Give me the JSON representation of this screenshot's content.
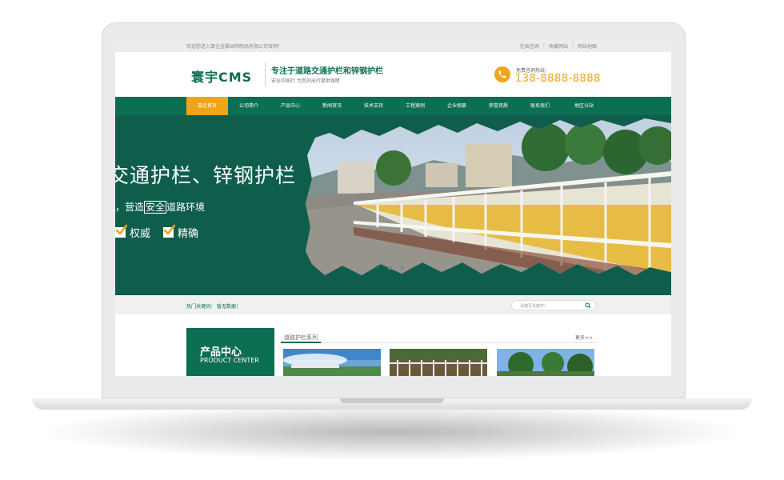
{
  "topbar": {
    "welcome": "欢迎您进入寰企金属丝网制品有限公司官网！",
    "links": [
      "在线咨询",
      "收藏网站",
      "网站地图"
    ]
  },
  "header": {
    "logo": "寰宇CMS",
    "slogan": "专注于道路交通护栏和锌钢护栏",
    "subslogan": "安全中国行 为您的出行提供保障",
    "hotline_label": "免费咨询热线：",
    "hotline": "138-8888-8888"
  },
  "nav": {
    "items": [
      "寰企首页",
      "公司简介",
      "产品中心",
      "新闻资讯",
      "技术支持",
      "工程案例",
      "企业相册",
      "荣誉资质",
      "联系我们",
      "地区分站"
    ],
    "active_index": 0
  },
  "banner": {
    "headline": "交通护栏、锌钢护栏",
    "subline_pre": "，营造",
    "subline_boxed": "安全",
    "subline_post": "道路环境",
    "checks": [
      "权威",
      "精确"
    ],
    "slide_count": 3,
    "active_slide": 0
  },
  "hotbar": {
    "label": "热门关键词：  暂无数据！",
    "search_placeholder": "请填写关键字！"
  },
  "products": {
    "box_title": "产品中心",
    "box_sub": "PRODUCT CENTER",
    "category": "道路护栏系列",
    "more": "更多>>"
  },
  "colors": {
    "brand_green": "#0c6e53",
    "accent_orange": "#f0a419",
    "banner_green": "#0f5e4c"
  }
}
